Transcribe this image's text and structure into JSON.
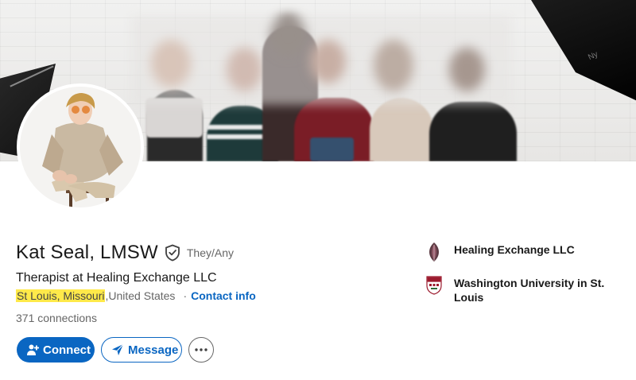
{
  "profile": {
    "name": "Kat Seal, LMSW",
    "pronouns": "They/Any",
    "headline": "Therapist at Healing Exchange LLC",
    "location_city": "St Louis, Missouri",
    "location_country": "United States",
    "separator": "·",
    "contact_label": "Contact info",
    "connections": "371 connections"
  },
  "actions": {
    "connect_label": "Connect",
    "message_label": "Message"
  },
  "experience": [
    {
      "name": "Healing Exchange LLC",
      "icon": "healing-exchange-logo"
    },
    {
      "name": "Washington University in St. Louis",
      "icon": "washu-shield-logo"
    }
  ],
  "banner": {
    "umbrella_label": "Ny"
  },
  "colors": {
    "accent": "#0a66c2",
    "highlight": "#ffe94a",
    "text_primary": "#191919",
    "text_secondary": "#666666"
  }
}
